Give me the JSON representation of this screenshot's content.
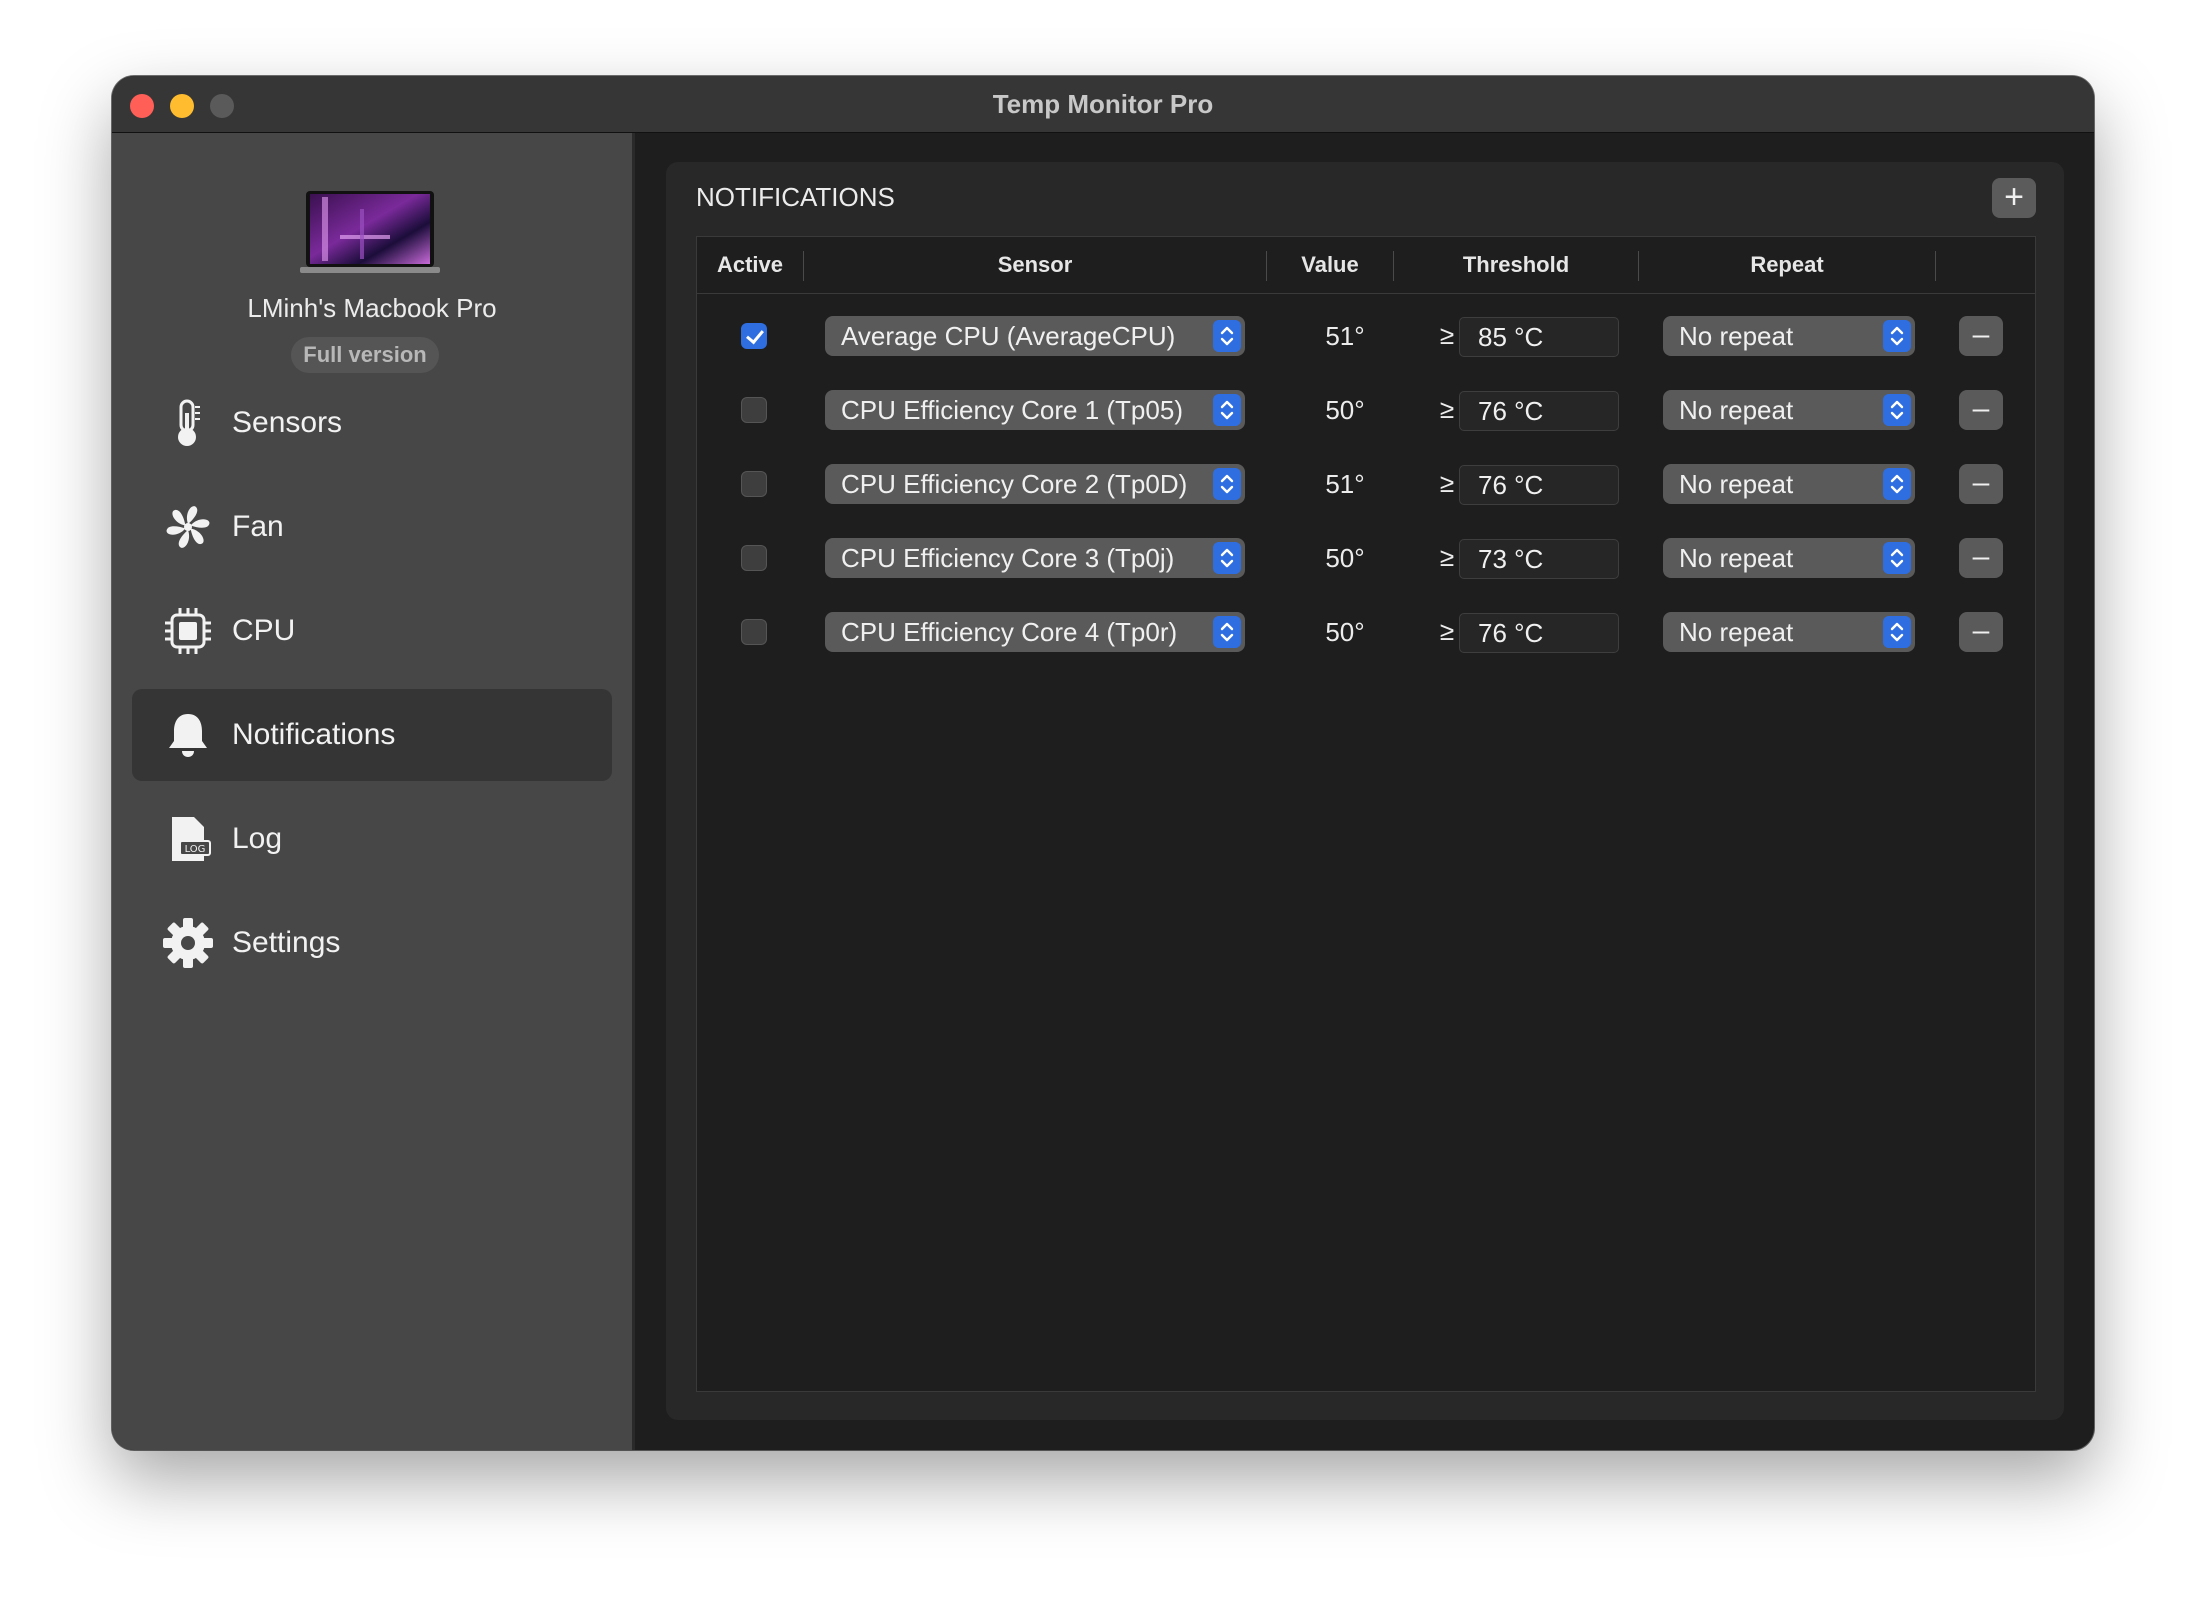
{
  "window": {
    "title": "Temp Monitor Pro"
  },
  "sidebar": {
    "device_name": "LMinh's Macbook Pro",
    "badge": "Full version",
    "items": [
      {
        "label": "Sensors",
        "icon": "thermometer-icon",
        "active": false
      },
      {
        "label": "Fan",
        "icon": "fan-icon",
        "active": false
      },
      {
        "label": "CPU",
        "icon": "cpu-icon",
        "active": false
      },
      {
        "label": "Notifications",
        "icon": "bell-icon",
        "active": true
      },
      {
        "label": "Log",
        "icon": "log-file-icon",
        "active": false
      },
      {
        "label": "Settings",
        "icon": "gear-icon",
        "active": false
      }
    ]
  },
  "notifications": {
    "title": "NOTIFICATIONS",
    "add_label": "+",
    "remove_label": "–",
    "comparator": "≥",
    "columns": [
      "Active",
      "Sensor",
      "Value",
      "Threshold",
      "Repeat"
    ],
    "rows": [
      {
        "active": true,
        "sensor": "Average CPU (AverageCPU)",
        "value": "51°",
        "threshold": "85 °C",
        "repeat": "No repeat"
      },
      {
        "active": false,
        "sensor": "CPU Efficiency Core 1 (Tp05)",
        "value": "50°",
        "threshold": "76 °C",
        "repeat": "No repeat"
      },
      {
        "active": false,
        "sensor": "CPU Efficiency Core 2 (Tp0D)",
        "value": "51°",
        "threshold": "76 °C",
        "repeat": "No repeat"
      },
      {
        "active": false,
        "sensor": "CPU Efficiency Core 3 (Tp0j)",
        "value": "50°",
        "threshold": "73 °C",
        "repeat": "No repeat"
      },
      {
        "active": false,
        "sensor": "CPU Efficiency Core 4 (Tp0r)",
        "value": "50°",
        "threshold": "76 °C",
        "repeat": "No repeat"
      }
    ]
  },
  "colors": {
    "accent": "#2f6ee0",
    "close": "#ff5f57",
    "minimize": "#febc2e"
  }
}
